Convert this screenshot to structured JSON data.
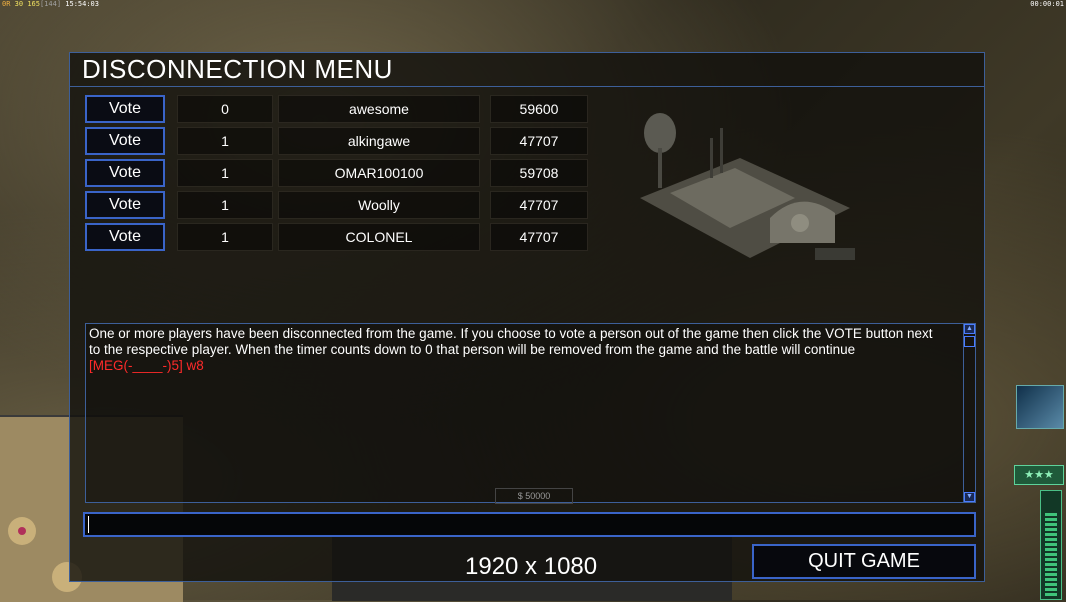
{
  "hud": {
    "fps_prefix": "0R",
    "fps_value": "30",
    "frame": "165",
    "frame_extra": "[144]",
    "clock": "15:54:03",
    "timer": "00:00:01"
  },
  "dialog": {
    "title": "DISCONNECTION MENU",
    "vote_label": "Vote",
    "players": [
      {
        "count": "0",
        "name": "awesome",
        "time": "59600"
      },
      {
        "count": "1",
        "name": "alkingawe",
        "time": "47707"
      },
      {
        "count": "1",
        "name": "OMAR100100",
        "time": "59708"
      },
      {
        "count": "1",
        "name": "Woolly",
        "time": "47707"
      },
      {
        "count": "1",
        "name": "COLONEL",
        "time": "47707"
      }
    ],
    "log_lines": [
      "One or more players have been disconnected from the game. If you choose to vote a person out of the game then click the VOTE button next",
      " to the respective player. When the timer counts down to 0 that person will be removed from the game and the battle will continue"
    ],
    "log_chat": "[MEG(-____-)5] w8",
    "chat_value": "",
    "quit_label": "QUIT GAME",
    "resolution": "1920 x 1080",
    "money": "$ 50000"
  },
  "side": {
    "stars": "★★★"
  }
}
